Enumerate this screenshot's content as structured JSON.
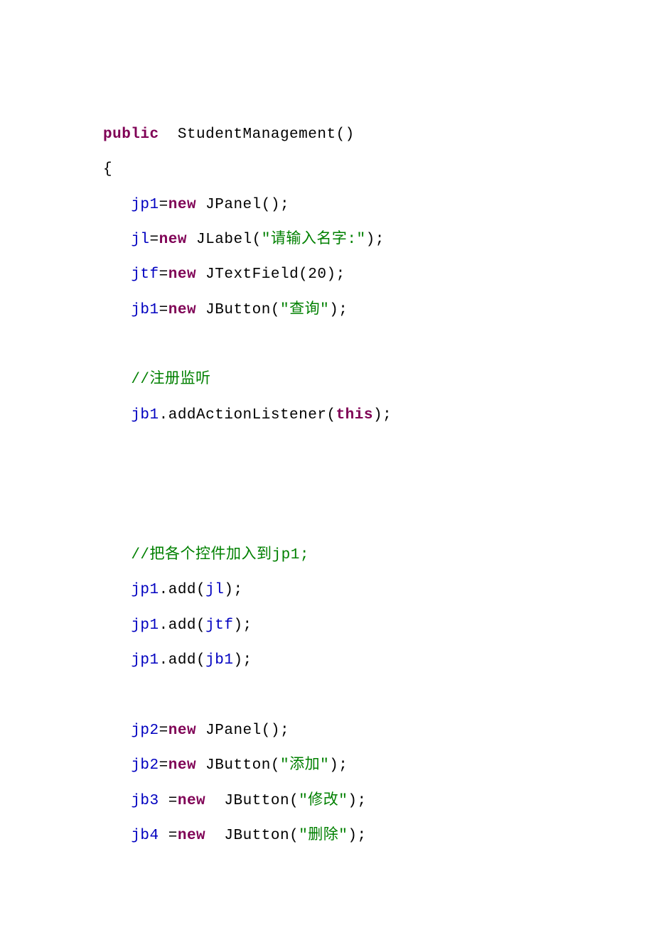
{
  "code": {
    "kw_public": "public",
    "sp1": "  StudentManagement()",
    "brace_open": "{",
    "indent": "   ",
    "l1_a": "jp1",
    "l1_b": "=",
    "l1_kw": "new",
    "l1_c": " JPanel();",
    "l2_a": "jl",
    "l2_b": "=",
    "l2_kw": "new",
    "l2_c": " JLabel(",
    "l2_str": "\"请输入名字:\"",
    "l2_d": ");",
    "l3_a": "jtf",
    "l3_b": "=",
    "l3_kw": "new",
    "l3_c": " JTextField(20);",
    "l4_a": "jb1",
    "l4_b": "=",
    "l4_kw": "new",
    "l4_c": " JButton(",
    "l4_str": "\"查询\"",
    "l4_d": ");",
    "cmt1": "//注册监听",
    "l5_a": "jb1",
    "l5_b": ".addActionListener(",
    "l5_kw": "this",
    "l5_c": ");",
    "cmt2": "//把各个控件加入到jp1;",
    "l6_a": "jp1",
    "l6_b": ".add(",
    "l6_c": "jl",
    "l6_d": ");",
    "l7_a": "jp1",
    "l7_b": ".add(",
    "l7_c": "jtf",
    "l7_d": ");",
    "l8_a": "jp1",
    "l8_b": ".add(",
    "l8_c": "jb1",
    "l8_d": ");",
    "l9_a": "jp2",
    "l9_b": "=",
    "l9_kw": "new",
    "l9_c": " JPanel();",
    "l10_a": "jb2",
    "l10_b": "=",
    "l10_kw": "new",
    "l10_c": " JButton(",
    "l10_str": "\"添加\"",
    "l10_d": ");",
    "l11_a": "jb3",
    "l11_sp": " =",
    "l11_kw": "new",
    "l11_c": "  JButton(",
    "l11_str": "\"修改\"",
    "l11_d": ");",
    "l12_a": "jb4",
    "l12_sp": " =",
    "l12_kw": "new",
    "l12_c": "  JButton(",
    "l12_str": "\"删除\"",
    "l12_d": ");"
  }
}
